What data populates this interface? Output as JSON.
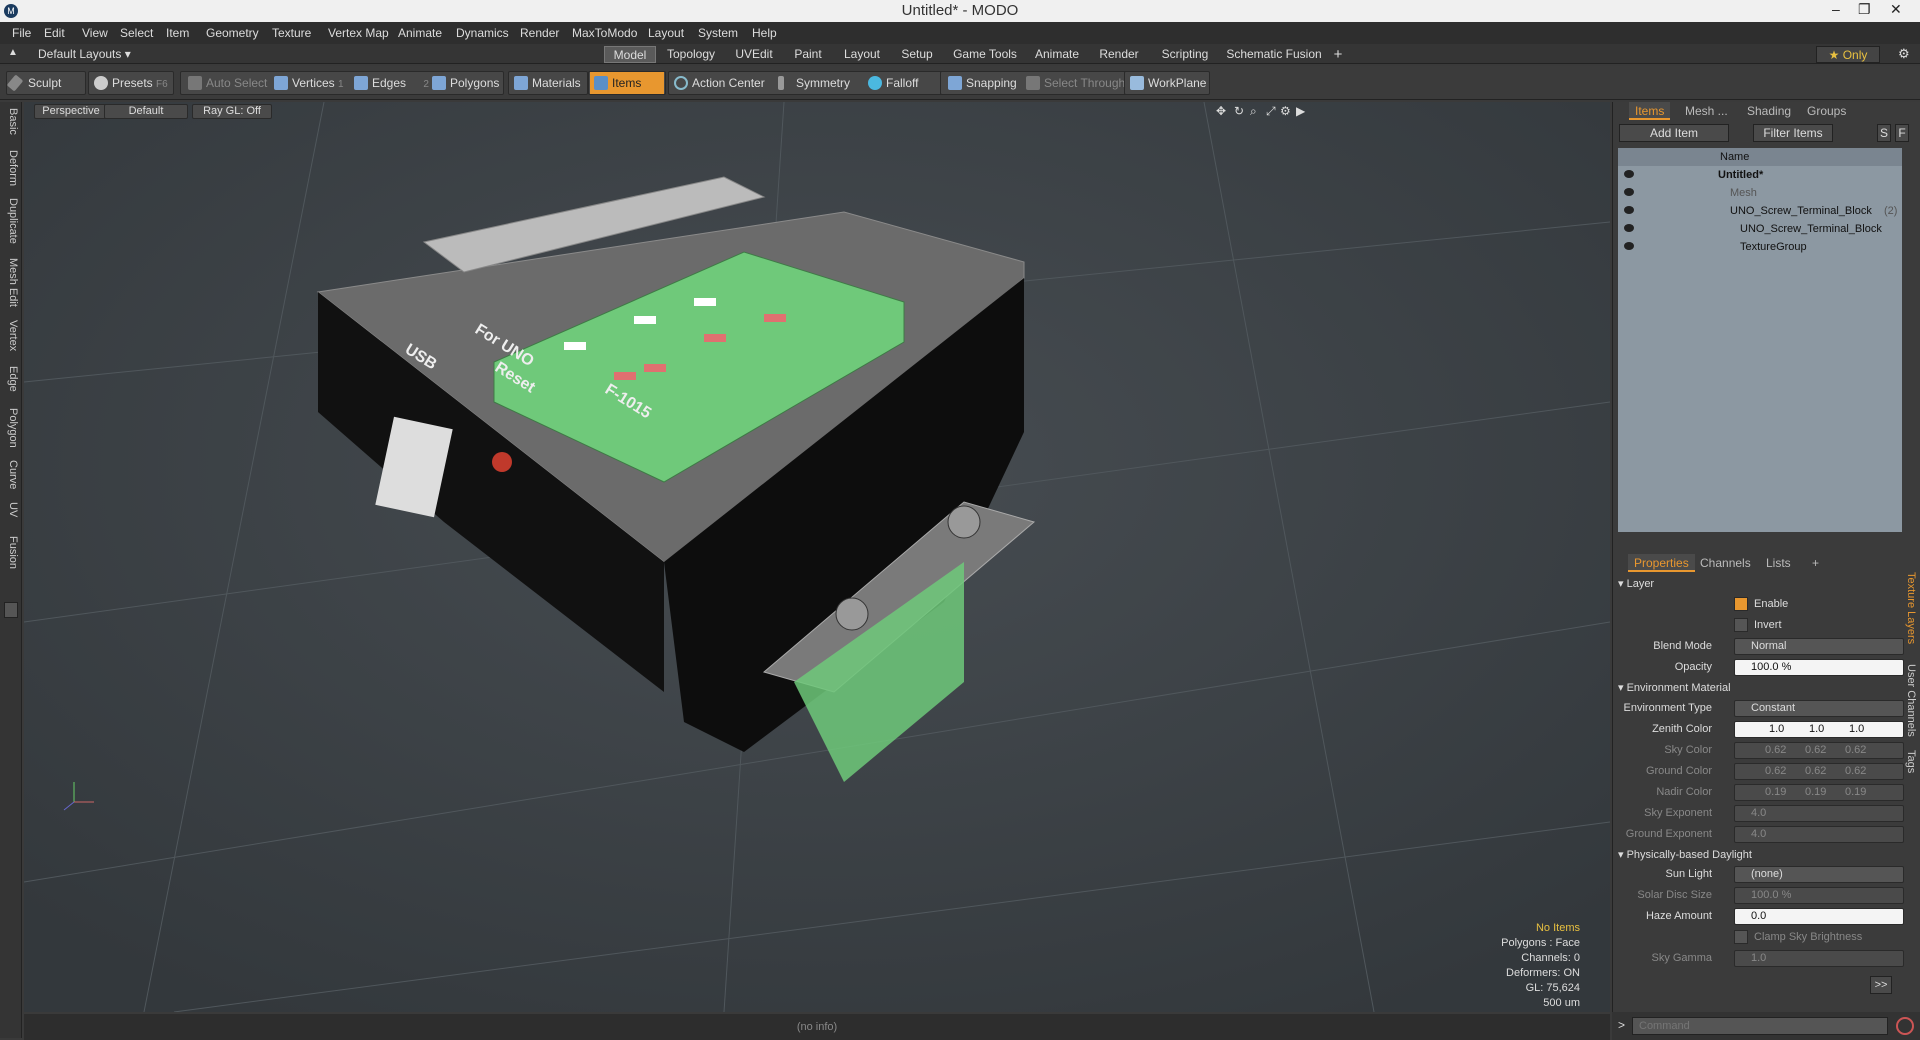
{
  "window": {
    "title": "Untitled* - MODO",
    "logo": "M"
  },
  "menu": [
    "File",
    "Edit",
    "View",
    "Select",
    "Item",
    "Geometry",
    "Texture",
    "Vertex Map",
    "Animate",
    "Dynamics",
    "Render",
    "MaxToModo",
    "Layout",
    "System",
    "Help"
  ],
  "layout": {
    "default_label": "Default Layouts ▾",
    "tabs": [
      "Model",
      "Topology",
      "UVEdit",
      "Paint",
      "Layout",
      "Setup",
      "Game Tools",
      "Animate",
      "Render",
      "Scripting",
      "Schematic Fusion"
    ],
    "active_tab": "Model",
    "plus": "+",
    "only": "★ Only"
  },
  "toolbar": {
    "sculpt": "Sculpt",
    "presets": "Presets",
    "presets_key": "F6",
    "auto_select": "Auto Select",
    "vertices": "Vertices",
    "vertices_count": "1",
    "edges": "Edges",
    "edges_count": "2",
    "polygons": "Polygons",
    "materials": "Materials",
    "items": "Items",
    "action_center": "Action Center",
    "symmetry": "Symmetry",
    "falloff": "Falloff",
    "snapping": "Snapping",
    "select_through": "Select Through",
    "workplane": "WorkPlane"
  },
  "left_tabs": [
    "Basic",
    "Deform",
    "Duplicate",
    "Mesh Edit",
    "Vertex",
    "Edge",
    "Polygon",
    "Curve",
    "UV",
    "Fusion"
  ],
  "viewport": {
    "view": "Perspective",
    "shading": "Default",
    "raygl": "Ray GL: Off",
    "info": {
      "no_items": "No Items",
      "polygons": "Polygons : Face",
      "channels": "Channels: 0",
      "deformers": "Deformers: ON",
      "gl": "GL: 75,624",
      "scale": "500 um"
    },
    "model_labels": {
      "usb": "USB",
      "for_uno": "For UNO",
      "reset": "Reset",
      "f1015": "F-1015"
    }
  },
  "status": "(no info)",
  "items_panel": {
    "tabs": [
      "Items",
      "Mesh ...",
      "Shading",
      "Groups"
    ],
    "add_item": "Add Item",
    "filter": "Filter Items",
    "s": "S",
    "f": "F",
    "name_header": "Name",
    "rows": [
      {
        "label": "Untitled*",
        "indent": 0
      },
      {
        "label": "Mesh",
        "indent": 1
      },
      {
        "label": "UNO_Screw_Terminal_Block",
        "suffix": "(2)",
        "indent": 1
      },
      {
        "label": "UNO_Screw_Terminal_Block",
        "indent": 2
      },
      {
        "label": "TextureGroup",
        "indent": 2
      }
    ]
  },
  "properties": {
    "tabs": [
      "Properties",
      "Channels",
      "Lists",
      "+"
    ],
    "layer": "Layer",
    "enable": "Enable",
    "invert": "Invert",
    "blend_mode_label": "Blend Mode",
    "blend_mode": "Normal",
    "opacity_label": "Opacity",
    "opacity": "100.0 %",
    "env_material": "Environment Material",
    "env_type_label": "Environment Type",
    "env_type": "Constant",
    "zenith_label": "Zenith Color",
    "zenith": [
      "1.0",
      "1.0",
      "1.0"
    ],
    "sky_label": "Sky Color",
    "sky": [
      "0.62",
      "0.62",
      "0.62"
    ],
    "ground_label": "Ground Color",
    "ground": [
      "0.62",
      "0.62",
      "0.62"
    ],
    "nadir_label": "Nadir Color",
    "nadir": [
      "0.19",
      "0.19",
      "0.19"
    ],
    "sky_exp_label": "Sky Exponent",
    "sky_exp": "4.0",
    "ground_exp_label": "Ground Exponent",
    "ground_exp": "4.0",
    "daylight": "Physically-based Daylight",
    "sun_label": "Sun Light",
    "sun": "(none)",
    "disc_label": "Solar Disc Size",
    "disc": "100.0 %",
    "haze_label": "Haze Amount",
    "haze": "0.0",
    "clamp": "Clamp Sky Brightness",
    "gamma_label": "Sky Gamma",
    "gamma": "1.0",
    "more": ">>"
  },
  "side_tabs": [
    "Texture Layers",
    "User Channels",
    "Tags"
  ],
  "command": {
    "placeholder": "Command"
  }
}
